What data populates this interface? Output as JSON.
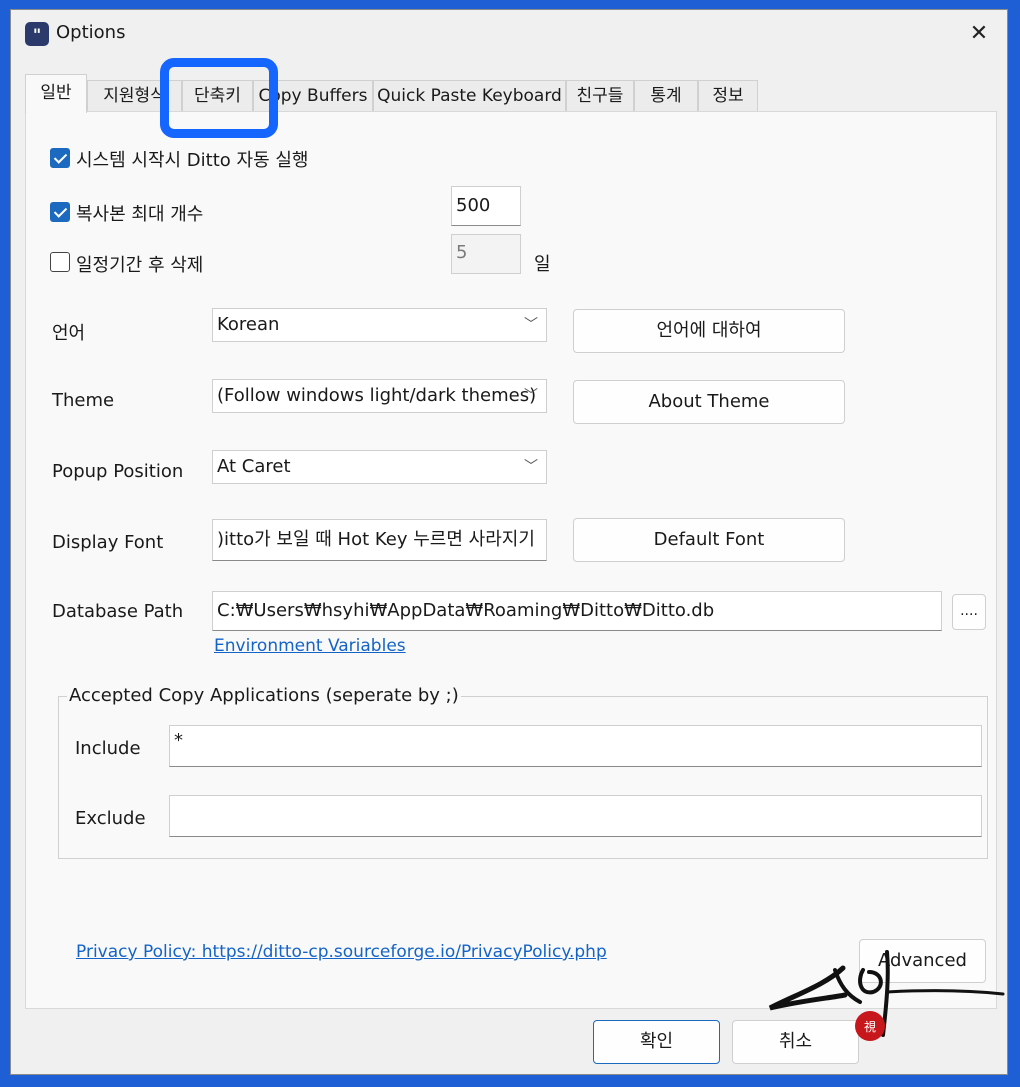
{
  "window": {
    "title": "Options",
    "app_icon_glyph": "\"",
    "close_glyph": "✕"
  },
  "tabs": [
    {
      "label": "일반",
      "active": true
    },
    {
      "label": "지원형식"
    },
    {
      "label": "단축키",
      "highlighted": true
    },
    {
      "label": "Copy Buffers"
    },
    {
      "label": "Quick Paste Keyboard"
    },
    {
      "label": "친구들"
    },
    {
      "label": "통계"
    },
    {
      "label": "정보"
    }
  ],
  "general": {
    "startup": {
      "label": "시스템 시작시 Ditto 자동 실행",
      "checked": true
    },
    "max_copies": {
      "label": "복사본 최대 개수",
      "checked": true,
      "value": "500"
    },
    "expire": {
      "label": "일정기간 후 삭제",
      "checked": false,
      "value": "5",
      "unit": "일"
    },
    "language": {
      "label": "언어",
      "value": "Korean",
      "button": "언어에 대하여"
    },
    "theme": {
      "label": "Theme",
      "value": "(Follow windows light/dark themes)",
      "button": "About Theme"
    },
    "popup_position": {
      "label": "Popup Position",
      "value": "At Caret"
    },
    "display_font": {
      "label": "Display Font",
      "value": ")itto가 보일 때 Hot Key 누르면 사라지기",
      "button": "Default Font"
    },
    "database_path": {
      "label": "Database Path",
      "value": "C:₩Users₩hsyhi₩AppData₩Roaming₩Ditto₩Ditto.db",
      "browse_label": "....",
      "env_link": "Environment Variables"
    },
    "accepted_apps": {
      "title": "Accepted Copy Applications (seperate by ;)",
      "include_label": "Include",
      "include_value": "*",
      "exclude_label": "Exclude",
      "exclude_value": ""
    },
    "privacy_link": "Privacy Policy: https://ditto-cp.sourceforge.io/PrivacyPolicy.php",
    "advanced_button": "Advanced"
  },
  "footer": {
    "ok": "확인",
    "cancel": "취소"
  },
  "colors": {
    "accent": "#1b6ac0",
    "highlight": "#1565ff",
    "desktop": "#1f5fd6",
    "seal": "#c8161d"
  }
}
